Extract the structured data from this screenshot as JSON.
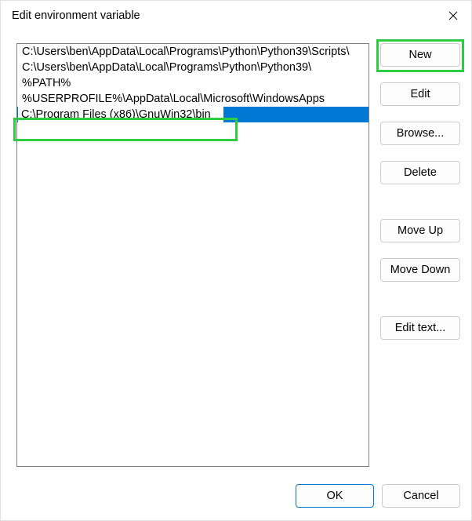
{
  "window": {
    "title": "Edit environment variable"
  },
  "list": {
    "items": [
      "C:\\Users\\ben\\AppData\\Local\\Programs\\Python\\Python39\\Scripts\\",
      "C:\\Users\\ben\\AppData\\Local\\Programs\\Python\\Python39\\",
      "%PATH%",
      "%USERPROFILE%\\AppData\\Local\\Microsoft\\WindowsApps"
    ],
    "editing_value": "C:\\Program Files (x86)\\GnuWin32\\bin"
  },
  "buttons": {
    "new": "New",
    "edit": "Edit",
    "browse": "Browse...",
    "delete": "Delete",
    "move_up": "Move Up",
    "move_down": "Move Down",
    "edit_text": "Edit text...",
    "ok": "OK",
    "cancel": "Cancel"
  }
}
